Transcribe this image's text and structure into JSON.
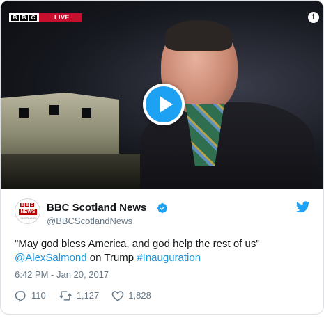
{
  "video": {
    "channel_logo": "BBC",
    "live_label": "LIVE",
    "info_symbol": "i",
    "play_icon": "play-icon"
  },
  "author": {
    "avatar_brand": "BBC",
    "avatar_label": "NEWS",
    "avatar_sub": "SCOTLAND",
    "name": "BBC Scotland News",
    "handle": "@BBCScotlandNews",
    "verified": true
  },
  "tweet": {
    "text_main": "\"May god bless America, and god help the rest of us\"",
    "mention": "@AlexSalmond",
    "text_mid": " on Trump ",
    "hashtag": "#Inauguration",
    "timestamp": "6:42 PM - Jan 20, 2017"
  },
  "actions": {
    "replies": "110",
    "retweets": "1,127",
    "likes": "1,828"
  },
  "colors": {
    "brand_blue": "#1da1f2",
    "link_blue": "#1b95e0",
    "bbc_red": "#c8102e",
    "muted": "#657786"
  }
}
